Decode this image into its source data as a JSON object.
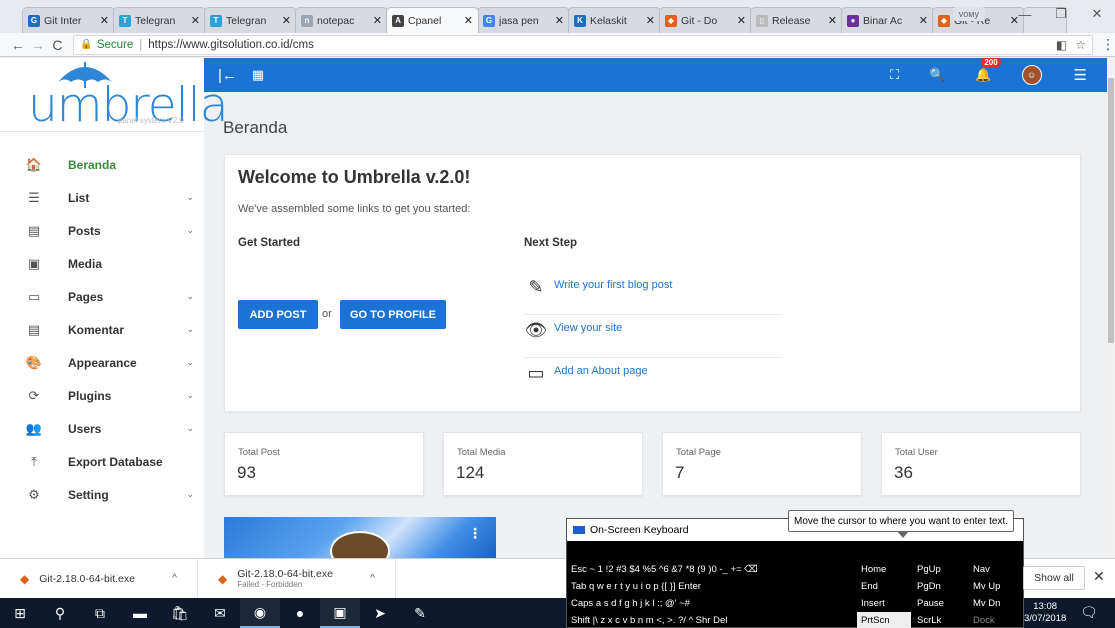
{
  "browser": {
    "tabs": [
      {
        "label": "Git Inter",
        "icon_color": "#1b6ec2",
        "icon": "G"
      },
      {
        "label": "Telegran",
        "icon_color": "#2aa3dd",
        "icon": "T"
      },
      {
        "label": "Telegran",
        "icon_color": "#2aa3dd",
        "icon": "T"
      },
      {
        "label": "notepac",
        "icon_color": "#9aa6b2",
        "icon": "n"
      },
      {
        "label": "Cpanel",
        "icon_color": "#444444",
        "icon": "A",
        "active": true
      },
      {
        "label": "jasa pen",
        "icon_color": "#4285f4",
        "icon": "G"
      },
      {
        "label": "Kelaskit",
        "icon_color": "#1b6ec2",
        "icon": "K"
      },
      {
        "label": "Git - Do",
        "icon_color": "#e0611a",
        "icon": "◆"
      },
      {
        "label": "Release",
        "icon_color": "#bbbbbb",
        "icon": "▯"
      },
      {
        "label": "Binar Ac",
        "icon_color": "#6a2fa0",
        "icon": "●"
      },
      {
        "label": "Git - Re",
        "icon_color": "#e0611a",
        "icon": "◆"
      }
    ],
    "profile": "ᴠᴏᴍy",
    "secure_label": "Secure",
    "url": "https://www.gitsolution.co.id/cms"
  },
  "sidebar": {
    "logo_text": "umbrella",
    "logo_sub": "panel system V2.0",
    "items": [
      {
        "label": "Beranda",
        "icon": "home-icon",
        "glyph": "🏠",
        "active": true,
        "chevron": false
      },
      {
        "label": "List",
        "icon": "list-icon",
        "glyph": "☰",
        "chevron": true
      },
      {
        "label": "Posts",
        "icon": "posts-icon",
        "glyph": "▤",
        "chevron": true
      },
      {
        "label": "Media",
        "icon": "media-icon",
        "glyph": "▣",
        "chevron": false
      },
      {
        "label": "Pages",
        "icon": "pages-icon",
        "glyph": "▭",
        "chevron": true
      },
      {
        "label": "Komentar",
        "icon": "comment-icon",
        "glyph": "▤",
        "chevron": true
      },
      {
        "label": "Appearance",
        "icon": "palette-icon",
        "glyph": "🎨",
        "chevron": true
      },
      {
        "label": "Plugins",
        "icon": "sync-icon",
        "glyph": "⟳",
        "chevron": true
      },
      {
        "label": "Users",
        "icon": "users-icon",
        "glyph": "👥",
        "chevron": true
      },
      {
        "label": "Export Database",
        "icon": "export-icon",
        "glyph": "⤒",
        "chevron": false
      },
      {
        "label": "Setting",
        "icon": "gear-icon",
        "glyph": "⚙",
        "chevron": true
      }
    ]
  },
  "topbar": {
    "notif_count": "200"
  },
  "main": {
    "page_title": "Beranda",
    "welcome": {
      "title": "Welcome to Umbrella v.2.0!",
      "intro": "We've assembled some links to get you started:",
      "get_started": "Get Started",
      "next_step": "Next Step",
      "add_post": "ADD POST",
      "or": "or",
      "go_profile": "GO TO PROFILE",
      "next_items": [
        {
          "label": "Write your first blog post",
          "icon": "pencil-icon"
        },
        {
          "label": "View your site",
          "icon": "eye-icon"
        },
        {
          "label": "Add an About page",
          "icon": "window-icon"
        }
      ]
    },
    "stats": [
      {
        "label": "Total Post",
        "value": "93"
      },
      {
        "label": "Total Media",
        "value": "124"
      },
      {
        "label": "Total Page",
        "value": "7"
      },
      {
        "label": "Total User",
        "value": "36"
      }
    ]
  },
  "downloads": {
    "items": [
      {
        "name": "Git-2.18.0-64-bit.exe",
        "sub": ""
      },
      {
        "name": "Git-2.18.0-64-bit.exe",
        "sub": "Failed - Forbidden"
      }
    ],
    "show_all": "Show all"
  },
  "osk": {
    "title": "On-Screen Keyboard",
    "tooltip": "Move the cursor to where you want to enter text.",
    "rows": [
      "Esc  ~  1  !2  #3  $4  %5  ^6  &7  *8  (9  )0  -_  +=  ⌫",
      "Tab  q  w  e  r  t  y  u  i  o  p  {[  }]   Enter",
      "Caps  a  s  d  f  g  h  j  k  l  :;  @'  ~#",
      "Shift  |\\  z  x  c  v  b  n  m  <,  >.  ?/  ^  Shr  Del"
    ],
    "right": [
      [
        "Home",
        "PgUp",
        "Nav"
      ],
      [
        "End",
        "PgDn",
        "Mv Up"
      ],
      [
        "Insert",
        "Pause",
        "Mv Dn"
      ],
      [
        "PrtScn",
        "ScrLk",
        "Dock"
      ]
    ]
  },
  "taskbar": {
    "time": "13:08",
    "date": "3/07/2018"
  }
}
